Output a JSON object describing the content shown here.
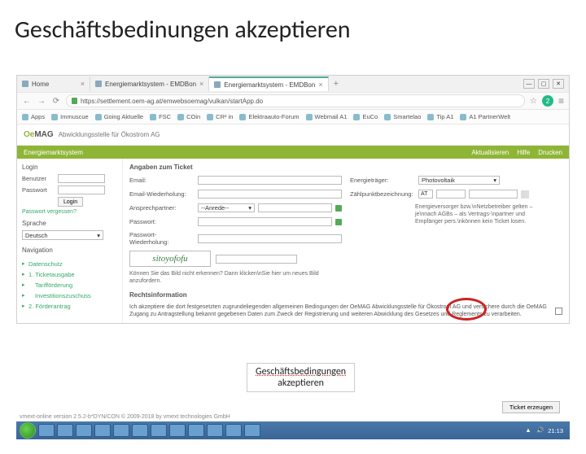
{
  "slide_title": "Geschäftsbedinungen akzeptieren",
  "tabs": [
    {
      "label": "Home"
    },
    {
      "label": "Energiemarktsystem - EMDBon"
    },
    {
      "label": "Energiemarktsystem - EMDBon"
    }
  ],
  "window_controls": {
    "min": "—",
    "max": "▢",
    "close": "✕"
  },
  "url": "https://settlement.oem-ag.at/emwebsoemag/vulkan/startApp.do",
  "address_icons": {
    "back": "←",
    "forward": "→",
    "reload": "⟳",
    "lock": "🔒",
    "star": "☆",
    "menu": "≡",
    "ext": "2"
  },
  "bookmarks": [
    "Apps",
    "Immuscue",
    "Going Aktuelle",
    "FSC",
    "COin",
    "CR² in",
    "Elektraauto-Forum",
    "Webmail A1",
    "EuCo",
    "Smartelao",
    "Tip A1",
    "A1 PartnerWelt"
  ],
  "logo_text": {
    "prefix": "Oe",
    "suffix": "MAG"
  },
  "subtitle": "Abwicklungsstelle für Ökostrom AG",
  "greenbar_label": "Energiemarktsystem",
  "greenbar_right": [
    "Aktualisieren",
    "Hilfe",
    "Drucken"
  ],
  "login_panel": {
    "title": "Login",
    "user_label": "Benutzer",
    "pass_label": "Passwort",
    "login_btn": "Login",
    "forgot": "Passwort vergessen?",
    "lang_label": "Sprache",
    "lang_value": "Deutsch",
    "nav_title": "Navigation",
    "nav_items": [
      "Datenschutz",
      "1. Ticketausgabe",
      "Tarifförderung",
      "Investitionszuschuss",
      "2. Förderantrag"
    ]
  },
  "ticket_form": {
    "title": "Angaben zum Ticket",
    "email": "Email:",
    "email_conf": "Email-Wiederholung:",
    "ansprech": "Ansprechpartner:",
    "anrede": "--Anrede--",
    "pass": "Passwort:",
    "pass_conf": "Passwort-Wiederholung:",
    "energ_label": "Energieträger:",
    "energ_val": "Photovoltaik",
    "zahl_label": "Zählpunktbezeichnung:",
    "zp_prefix": "AT",
    "hint_text": "Energieversorger bzw.\\nNetzbetreiber gelten – je\\nnach AGBs – als Vertrags-\\npartner und Empfänger pers.\\nkönnen kein Ticket losen.",
    "captcha_label": "sitoyofofu",
    "captcha_help": "Können Sie das Bild nicht erkennen? Dann klicken\\nSie hier um neues Bild anzufordern.",
    "legal_title": "Rechtsinformation",
    "legal_text": "Ich akzeptiere die dort festgesetzten zugrundeliegenden allgemeinen Bedingungen der OeMAG Abwicklungsstelle für Ökostrom AG und versichere durch die OeMAG Zugang zu Antragstellung bekannt gegebenen Daten zum Zweck der Registrierung und weiteren Abwicklung des Gesetzes und Reglements zu verarbeiten.",
    "submit": "Ticket erzeugen"
  },
  "overlay": {
    "line1": "Geschäftsbedingungen",
    "line2": "akzeptieren"
  },
  "version": "vmext-online version 2.5.2-b*DYN/CON © 2009-2018  by vmext technologies GmbH",
  "tray": {
    "time": "21:13"
  }
}
